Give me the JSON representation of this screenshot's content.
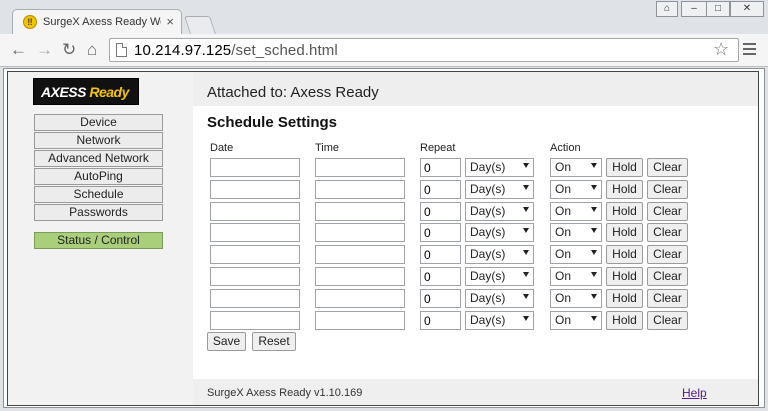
{
  "browser": {
    "tab_title": "SurgeX Axess Ready Web Pä",
    "tab_icon_glyph": "‼",
    "url_host": "10.214.97.125",
    "url_path": "/set_sched.html",
    "nav_back_glyph": "←",
    "nav_forward_glyph": "→",
    "nav_reload_glyph": "↻",
    "nav_home_glyph": "⌂",
    "star_glyph": "☆",
    "close_glyph": "×",
    "window_buttons": {
      "user": "⌂",
      "minimize": "–",
      "maximize": "□",
      "close": "✕"
    }
  },
  "logo": {
    "axess": "AXESS",
    "ready": " Ready"
  },
  "sidebar": {
    "items": [
      "Device",
      "Network",
      "Advanced Network",
      "AutoPing",
      "Schedule",
      "Passwords"
    ],
    "status_button": "Status / Control"
  },
  "header": {
    "attached": "Attached to: Axess Ready"
  },
  "schedule": {
    "title": "Schedule Settings",
    "columns": {
      "date": "Date",
      "time": "Time",
      "repeat": "Repeat",
      "action": "Action"
    },
    "rows": [
      {
        "date": "",
        "time": "",
        "repeat": "0",
        "unit": "Day(s)",
        "action": "On"
      },
      {
        "date": "",
        "time": "",
        "repeat": "0",
        "unit": "Day(s)",
        "action": "On"
      },
      {
        "date": "",
        "time": "",
        "repeat": "0",
        "unit": "Day(s)",
        "action": "On"
      },
      {
        "date": "",
        "time": "",
        "repeat": "0",
        "unit": "Day(s)",
        "action": "On"
      },
      {
        "date": "",
        "time": "",
        "repeat": "0",
        "unit": "Day(s)",
        "action": "On"
      },
      {
        "date": "",
        "time": "",
        "repeat": "0",
        "unit": "Day(s)",
        "action": "On"
      },
      {
        "date": "",
        "time": "",
        "repeat": "0",
        "unit": "Day(s)",
        "action": "On"
      },
      {
        "date": "",
        "time": "",
        "repeat": "0",
        "unit": "Day(s)",
        "action": "On"
      }
    ],
    "hold_label": "Hold",
    "clear_label": "Clear",
    "save_label": "Save",
    "reset_label": "Reset"
  },
  "footer": {
    "version": "SurgeX Axess Ready v1.10.169",
    "help": "Help"
  }
}
